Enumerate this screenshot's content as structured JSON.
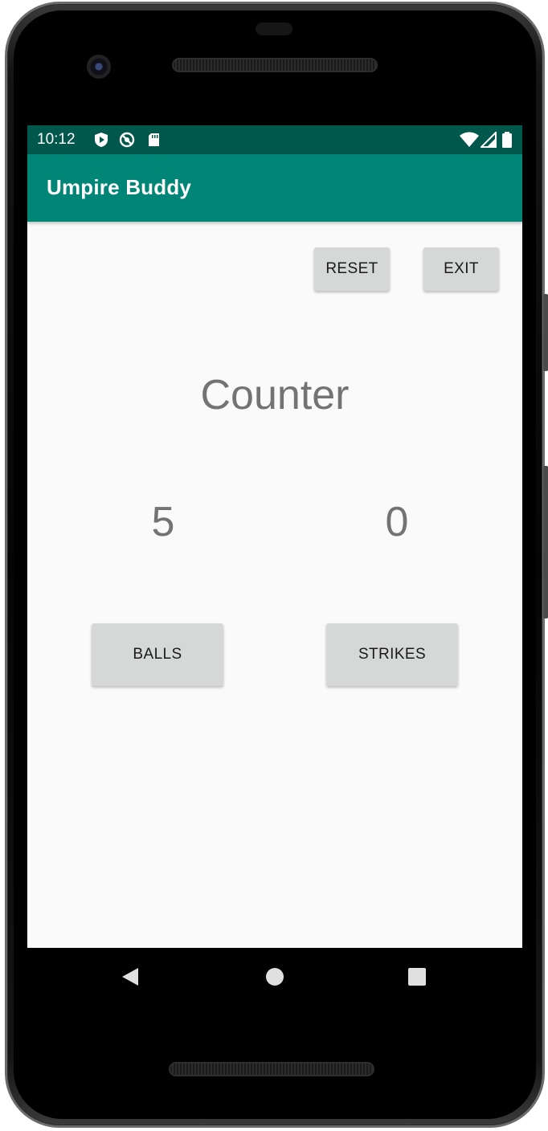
{
  "status_bar": {
    "time": "10:12",
    "left_icons": [
      "shield-play-icon",
      "no-sync-icon",
      "sd-card-icon"
    ],
    "right_icons": [
      "wifi-icon",
      "cell-signal-icon",
      "battery-icon"
    ]
  },
  "app_bar": {
    "title": "Umpire Buddy",
    "color": "#008577",
    "status_color": "#00574b"
  },
  "toolbar": {
    "reset_label": "RESET",
    "exit_label": "EXIT"
  },
  "main": {
    "title": "Counter",
    "balls_count": "5",
    "strikes_count": "0",
    "balls_label": "BALLS",
    "strikes_label": "STRIKES"
  },
  "nav_bar": {
    "buttons": [
      "back-icon",
      "home-icon",
      "recents-icon"
    ]
  }
}
